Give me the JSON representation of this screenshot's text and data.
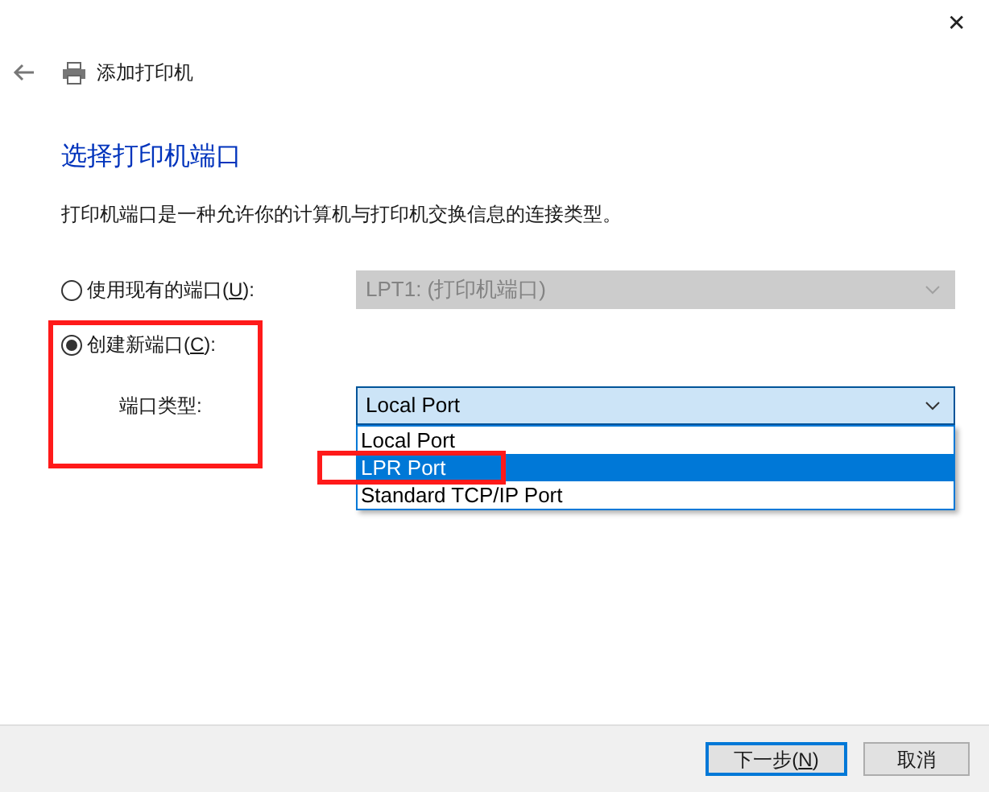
{
  "window": {
    "title": "添加打印机",
    "close": "✕"
  },
  "heading": "选择打印机端口",
  "description": "打印机端口是一种允许你的计算机与打印机交换信息的连接类型。",
  "options": [
    {
      "label_before": "使用现有的端口(",
      "access_key": "U",
      "label_after": "):",
      "selected": false,
      "combo": {
        "value": "LPT1: (打印机端口)",
        "disabled": true
      }
    },
    {
      "label_before": "创建新端口(",
      "access_key": "C",
      "label_after": "):",
      "selected": true,
      "combo": {
        "label": "端口类型:",
        "value": "Local Port",
        "disabled": false,
        "expanded": true,
        "items": [
          {
            "label": "Local Port",
            "highlighted": false
          },
          {
            "label": "LPR Port",
            "highlighted": true
          },
          {
            "label": "Standard TCP/IP Port",
            "highlighted": false
          }
        ]
      }
    }
  ],
  "annotations": [
    {
      "kind": "box",
      "color": "#ff1a1a"
    },
    {
      "kind": "box",
      "color": "#ff1a1a"
    }
  ],
  "buttons": [
    {
      "label_before": "下一步(",
      "access_key": "N",
      "label_after": ")",
      "default": true
    },
    {
      "label_before": "取消",
      "default": false
    }
  ]
}
